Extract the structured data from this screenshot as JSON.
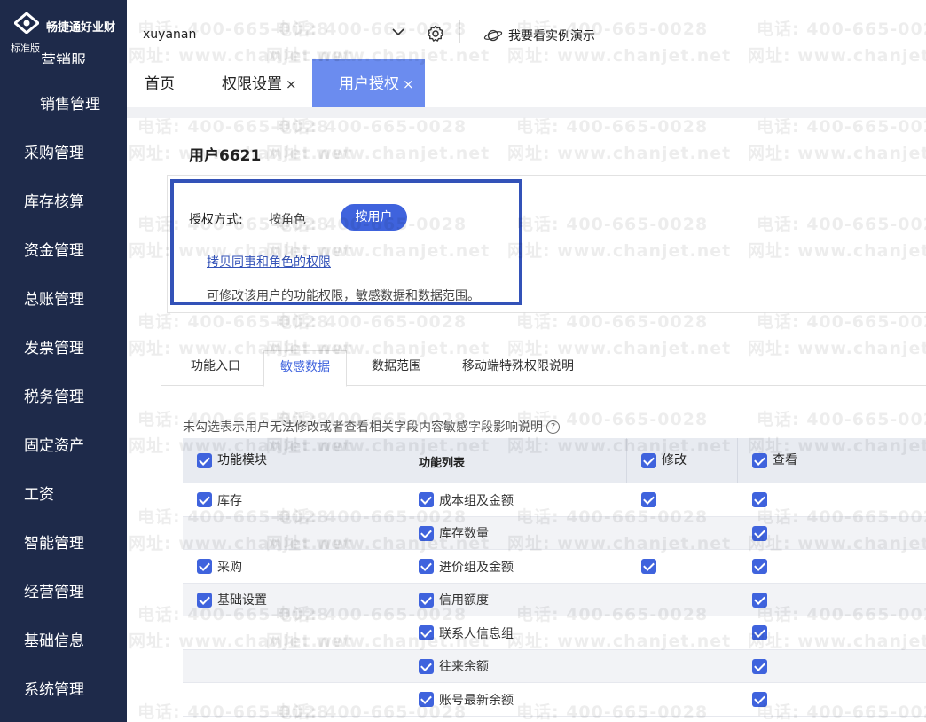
{
  "app": {
    "brand": "畅捷通好业财",
    "edition": "标准版"
  },
  "sidebar": {
    "cut_item": "营销服",
    "items": [
      {
        "label": "销售管理"
      },
      {
        "label": "采购管理"
      },
      {
        "label": "库存核算"
      },
      {
        "label": "资金管理"
      },
      {
        "label": "总账管理"
      },
      {
        "label": "发票管理"
      },
      {
        "label": "税务管理"
      },
      {
        "label": "固定资产"
      },
      {
        "label": "工资"
      },
      {
        "label": "智能管理"
      },
      {
        "label": "经营管理"
      },
      {
        "label": "基础信息"
      },
      {
        "label": "系统管理"
      }
    ]
  },
  "topbar": {
    "user": "xuyanan",
    "demo_label": "我要看实例演示"
  },
  "tabs": [
    {
      "label": "首页",
      "closable": false
    },
    {
      "label": "权限设置",
      "closable": true
    },
    {
      "label": "用户授权",
      "closable": true,
      "active": true
    }
  ],
  "close_glyph": "×",
  "page": {
    "title": "用户6621",
    "auth_label": "授权方式:",
    "auth_by_role": "按角色",
    "auth_by_user": "按用户",
    "copy_link": "拷贝同事和角色的权限",
    "desc": "可修改该用户的功能权限，敏感数据和数据范围。"
  },
  "subtabs": [
    {
      "label": "功能入口"
    },
    {
      "label": "敏感数据",
      "active": true
    },
    {
      "label": "数据范围"
    },
    {
      "label": "移动端特殊权限说明"
    }
  ],
  "note": "未勾选表示用户无法修改或者查看相关字段内容敏感字段影响说明",
  "help_glyph": "?",
  "table": {
    "headers": [
      "功能模块",
      "功能列表",
      "修改",
      "查看"
    ],
    "rows": [
      {
        "module": "库存",
        "field": "成本组及金额",
        "modify": true,
        "view": true
      },
      {
        "module": "",
        "field": "库存数量",
        "modify": false,
        "view": true
      },
      {
        "module": "采购",
        "field": "进价组及金额",
        "modify": true,
        "view": true
      },
      {
        "module": "基础设置",
        "field": "信用额度",
        "modify": false,
        "view": true
      },
      {
        "module": "",
        "field": "联系人信息组",
        "modify": false,
        "view": true
      },
      {
        "module": "",
        "field": "往来余额",
        "modify": false,
        "view": true
      },
      {
        "module": "",
        "field": "账号最新余额",
        "modify": false,
        "view": true
      }
    ]
  },
  "watermark": {
    "phone": "电话: 400-665-0028",
    "site": "网址: www.chanjet.net"
  }
}
